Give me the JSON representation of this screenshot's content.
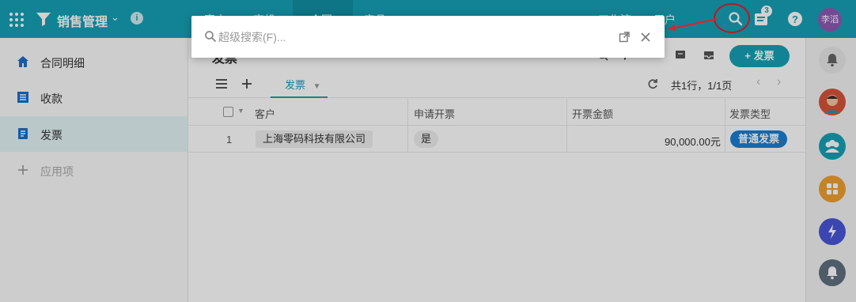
{
  "header": {
    "app_title": "销售管理",
    "tabs": [
      "客户",
      "商机",
      "合同",
      "产品"
    ],
    "right_nav": [
      "工作流",
      "用户"
    ],
    "notification_count": "3",
    "user_initials": "李滔",
    "accent": "#16a0b5"
  },
  "sidebar": {
    "items": [
      {
        "label": "合同明细",
        "icon": "home-icon"
      },
      {
        "label": "收款",
        "icon": "ledger-icon"
      },
      {
        "label": "发票",
        "icon": "invoice-icon",
        "active": true
      },
      {
        "label": "应用项",
        "icon": "plus-icon"
      }
    ]
  },
  "main": {
    "page_title": "发票",
    "add_button": "+ 发票",
    "view_tab": "发票",
    "pagination": "共1行，1/1页",
    "columns": [
      "客户",
      "申请开票",
      "开票金额",
      "发票类型"
    ],
    "rows": [
      {
        "num": "1",
        "customer": "上海零码科技有限公司",
        "apply": "是",
        "amount": "90,000.00元",
        "type": "普通发票"
      }
    ]
  },
  "search": {
    "placeholder": "超级搜索(F)..."
  },
  "rail": {
    "icons": [
      "bell-icon",
      "person-avatar-icon",
      "group-icon",
      "apps-icon",
      "ai-sparkle-icon",
      "notification-icon"
    ]
  }
}
